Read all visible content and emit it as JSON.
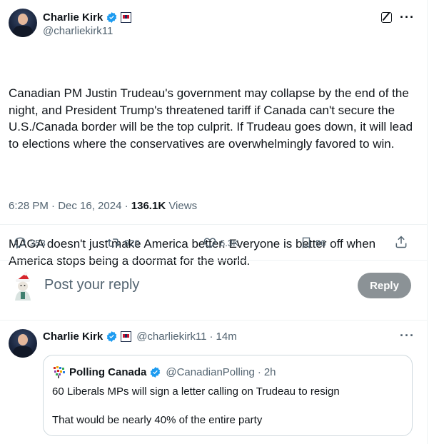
{
  "tweet": {
    "author_name": "Charlie Kirk",
    "author_handle": "@charliekirk11",
    "paragraph1": "Canadian PM Justin Trudeau's government may collapse by the end of the night, and President Trump's threatened tariff if Canada can't secure the U.S./Canada border will be the top culprit. If Trudeau goes down, it will lead to elections where the conservatives are overwhelmingly favored to win.",
    "paragraph2": "MAGA doesn't just make America better. Everyone is better off when America stops being a doormat for the world.",
    "timestamp": "6:28 PM · Dec 16, 2024",
    "views_count": "136.1K",
    "views_label": "Views"
  },
  "actions": {
    "replies": "353",
    "reposts": "920",
    "likes": "6.3K",
    "bookmarks": "96"
  },
  "composer": {
    "placeholder": "Post your reply",
    "reply_button": "Reply"
  },
  "reply": {
    "author_name": "Charlie Kirk",
    "author_handle": "@charliekirk11",
    "time": "14m",
    "quote": {
      "author_name": "Polling Canada",
      "author_handle": "@CanadianPolling",
      "time": "2h",
      "line1": "60 Liberals MPs will sign a letter calling on Trudeau to resign",
      "line2": "That would be nearly 40% of the entire party"
    }
  },
  "colors": {
    "verified": "#1d9bf0",
    "text": "#0f1419",
    "secondary": "#536471",
    "reply_button": "#8b9296"
  }
}
